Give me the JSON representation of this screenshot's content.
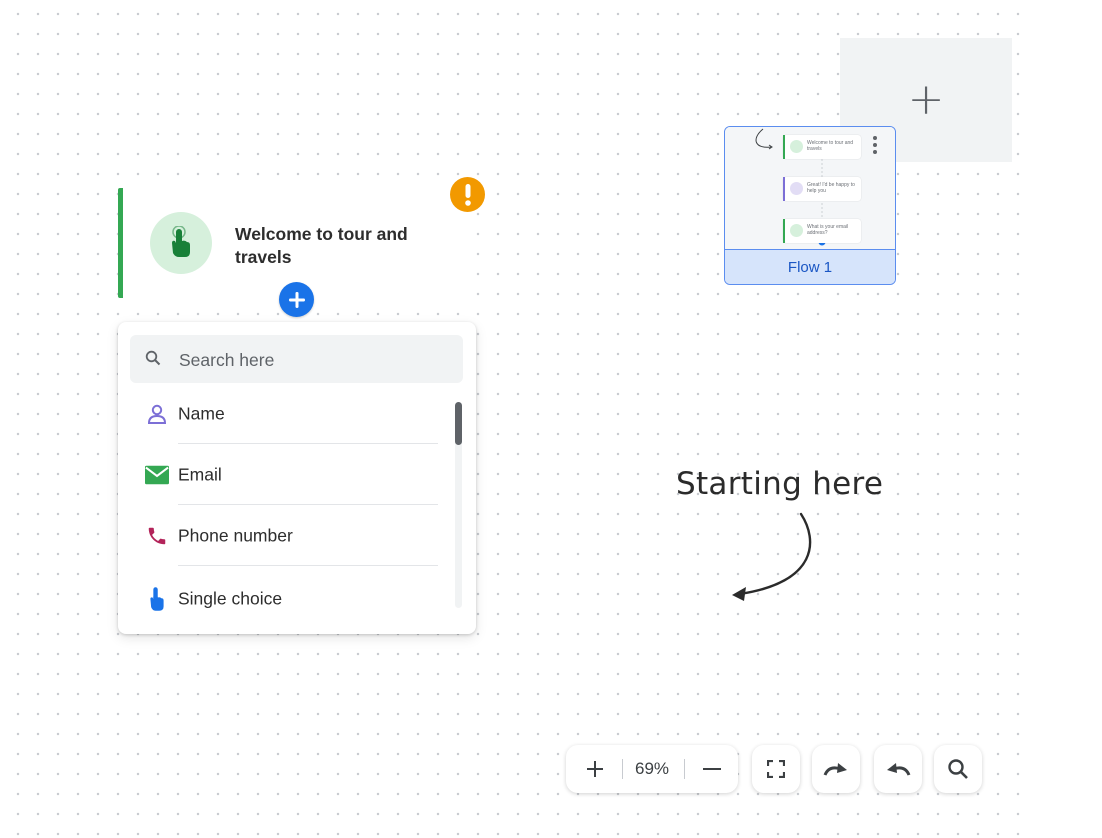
{
  "canvas": {
    "add_flow_label": "+"
  },
  "flow_card": {
    "name": "Flow 1",
    "preview_nodes": [
      {
        "text": "Welcome to tour and travels",
        "bar_color": "#34a853",
        "dot_color": "#d6f0dc"
      },
      {
        "text": "Great! I'd be happy to help you",
        "bar_color": "#7c6fd6",
        "dot_color": "#e2ddf5"
      },
      {
        "text": "What is your email address?",
        "bar_color": "#34a853",
        "dot_color": "#d6f0dc"
      }
    ]
  },
  "welcome_node": {
    "title": "Welcome to tour and travels",
    "accent_color": "#34a853",
    "warning_icon": "exclamation-icon"
  },
  "picker": {
    "search_placeholder": "Search here",
    "items": [
      {
        "label": "Name",
        "icon": "person-icon",
        "color": "#7c6fd6"
      },
      {
        "label": "Email",
        "icon": "mail-icon",
        "color": "#34a853"
      },
      {
        "label": "Phone number",
        "icon": "phone-icon",
        "color": "#b3245a"
      },
      {
        "label": "Single choice",
        "icon": "tap-icon",
        "color": "#1a73e8"
      }
    ]
  },
  "annotation": {
    "text": "Starting here"
  },
  "toolbar": {
    "zoom_level": "69%"
  },
  "colors": {
    "primary": "#1a73e8",
    "warning": "#f29900",
    "success": "#34a853"
  }
}
